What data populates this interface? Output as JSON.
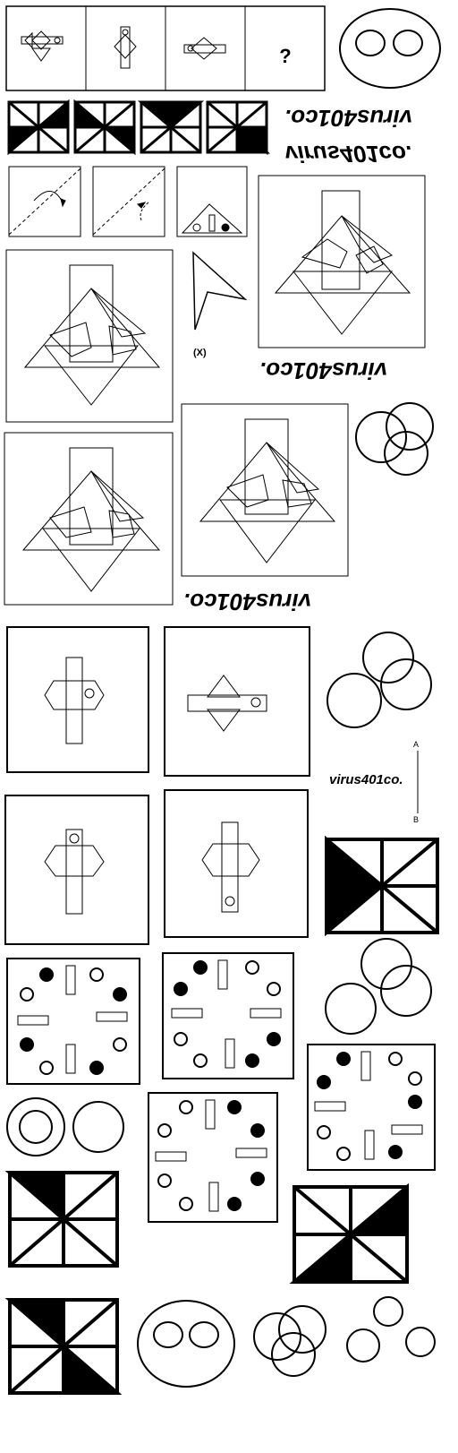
{
  "sequence_question": "?",
  "watermark": "virus401co.",
  "x_label": "(X)",
  "point_a": "A",
  "point_b": "B",
  "colors": {
    "ink": "#000000",
    "paper": "#ffffff",
    "shade": "#000000"
  }
}
